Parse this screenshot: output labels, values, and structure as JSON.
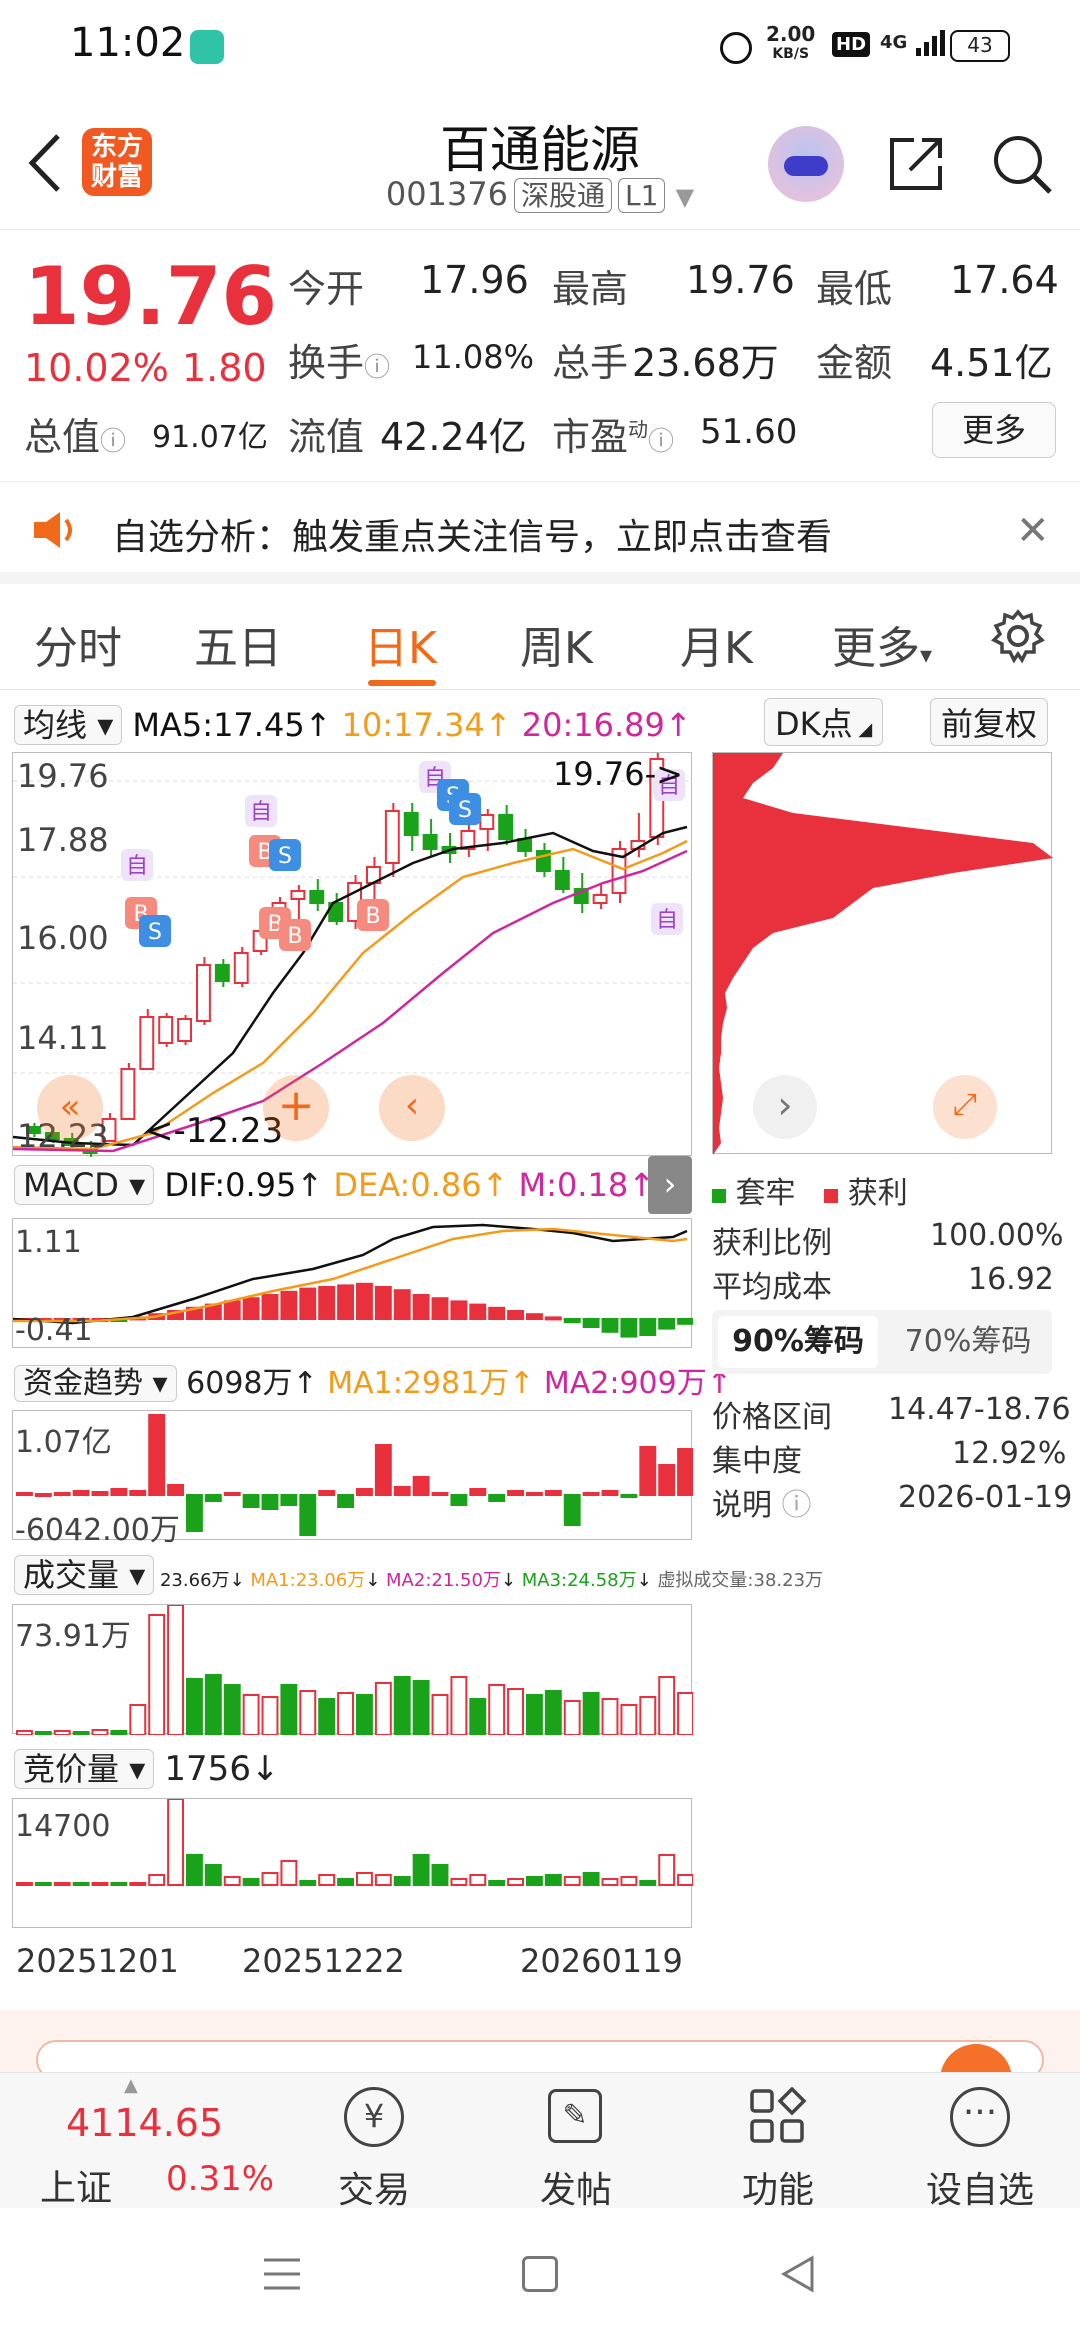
{
  "status": {
    "time": "11:02",
    "net_speed_top": "2.00",
    "net_speed_unit": "KB/S",
    "hd": "HD",
    "network": "4G",
    "battery": "43"
  },
  "header": {
    "logo_line1": "东方",
    "logo_line2": "财富",
    "title": "百通能源",
    "code": "001376",
    "tag1": "深股通",
    "tag2": "L1"
  },
  "quote": {
    "price": "19.76",
    "pct": "10.02%",
    "change": "1.80",
    "open_label": "今开",
    "open": "17.96",
    "high_label": "最高",
    "high": "19.76",
    "low_label": "最低",
    "low": "17.64",
    "turnover_label": "换手",
    "turnover": "11.08%",
    "volume_label": "总手",
    "volume": "23.68万",
    "amount_label": "金额",
    "amount": "4.51亿",
    "mktcap_label": "总值",
    "mktcap": "91.07亿",
    "float_label": "流值",
    "float": "42.24亿",
    "pe_label": "市盈",
    "pe_sup": "动",
    "pe": "51.60",
    "more": "更多"
  },
  "banner": {
    "text": "自选分析：触发重点关注信号，立即点击查看"
  },
  "tabs": [
    {
      "label": "分时"
    },
    {
      "label": "五日"
    },
    {
      "label": "日K"
    },
    {
      "label": "周K"
    },
    {
      "label": "月K"
    },
    {
      "label": "更多"
    }
  ],
  "kline": {
    "ma_select": "均线",
    "ma5": "MA5:17.45",
    "ma10": "10:17.34",
    "ma20": "20:16.89",
    "dk": "DK点",
    "fq": "前复权",
    "y_labels": [
      "19.76",
      "17.88",
      "16.00",
      "14.11",
      "12.23"
    ],
    "high_marker": "19.76->",
    "low_marker": "<-12.23",
    "tag_zi": "自",
    "tag_b": "B",
    "tag_s": "S"
  },
  "macd": {
    "select": "MACD",
    "dif": "DIF:0.95",
    "dea": "DEA:0.86",
    "m": "M:0.18",
    "y_top": "1.11",
    "y_bot": "-0.41"
  },
  "fund": {
    "select": "资金趋势",
    "v": "6098万",
    "ma1": "MA1:2981万",
    "ma2": "MA2:909万",
    "y_top": "1.07亿",
    "y_bot": "-6042.00万"
  },
  "vol": {
    "select": "成交量",
    "info1": "23.66万",
    "info2": "MA1:23.06万",
    "info3": "MA2:21.50万",
    "info4": "MA3:24.58万",
    "info5": "虚拟成交量:38.23万",
    "y_top": "73.91万"
  },
  "auction": {
    "select": "竞价量",
    "v": "1756",
    "y_top": "14700"
  },
  "dates": [
    "20251201",
    "20251222",
    "20260119"
  ],
  "chips": {
    "legend_a": "套牢",
    "legend_b": "获利",
    "profit_ratio_label": "获利比例",
    "profit_ratio": "100.00%",
    "avg_cost_label": "平均成本",
    "avg_cost": "16.92",
    "tab90": "90%筹码",
    "tab70": "70%筹码",
    "range_label": "价格区间",
    "range": "14.47-18.76",
    "conc_label": "集中度",
    "conc": "12.92%",
    "note_label": "说明",
    "note": "2026-01-19"
  },
  "bottom": {
    "index_value": "4114.65",
    "index_name": "上证",
    "index_pct": "0.31%",
    "trade": "交易",
    "post": "发帖",
    "func": "功能",
    "watch": "设自选"
  },
  "colors": {
    "up": "#e8313c",
    "down": "#1aa21a",
    "accent": "#f06a1a"
  }
}
